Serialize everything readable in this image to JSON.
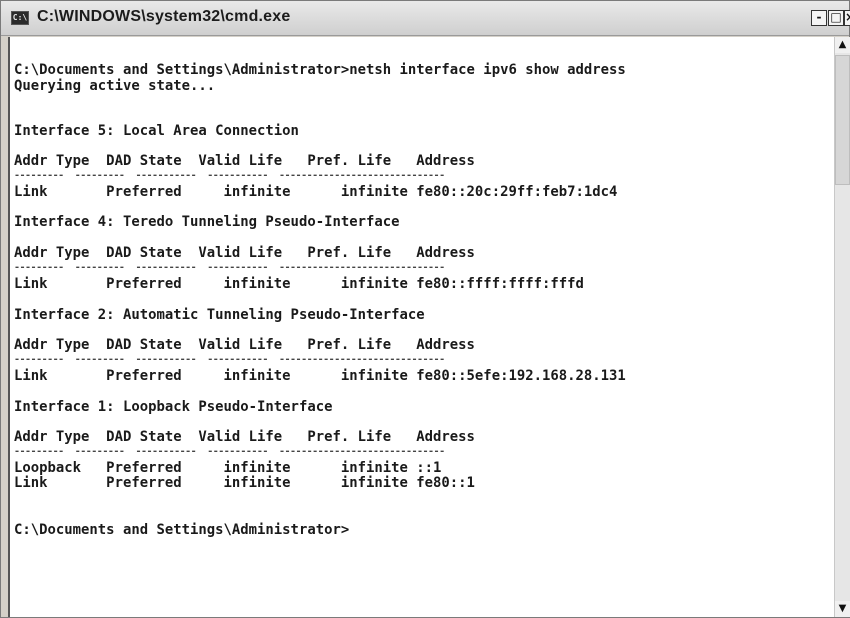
{
  "window": {
    "title": "C:\\WINDOWS\\system32\\cmd.exe",
    "icon_text": "C:\\",
    "controls": {
      "minimize": "-",
      "maximize": "□",
      "close": "×"
    }
  },
  "console": {
    "lines": [
      "C:\\Documents and Settings\\Administrator>netsh interface ipv6 show address",
      "Querying active state...",
      "",
      "Interface 5: Local Area Connection",
      "Addr Type  DAD State  Valid Life   Pref. Life   Address",
      "Link       Preferred     infinite      infinite fe80::20c:29ff:feb7:1dc4",
      "Interface 4: Teredo Tunneling Pseudo-Interface",
      "Addr Type  DAD State  Valid Life   Pref. Life   Address",
      "Link       Preferred     infinite      infinite fe80::ffff:ffff:fffd",
      "Interface 2: Automatic Tunneling Pseudo-Interface",
      "Addr Type  DAD State  Valid Life   Pref. Life   Address",
      "Link       Preferred     infinite      infinite fe80::5efe:192.168.28.131",
      "Interface 1: Loopback Pseudo-Interface",
      "Addr Type  DAD State  Valid Life   Pref. Life   Address",
      "Loopback   Preferred     infinite      infinite ::1",
      "Link       Preferred     infinite      infinite fe80::1",
      "",
      "C:\\Documents and Settings\\Administrator>"
    ],
    "separator": "---------  ---------  -----------  -----------  ------------------------------"
  },
  "scrollbar": {
    "up_arrow": "▲",
    "down_arrow": "▼"
  }
}
